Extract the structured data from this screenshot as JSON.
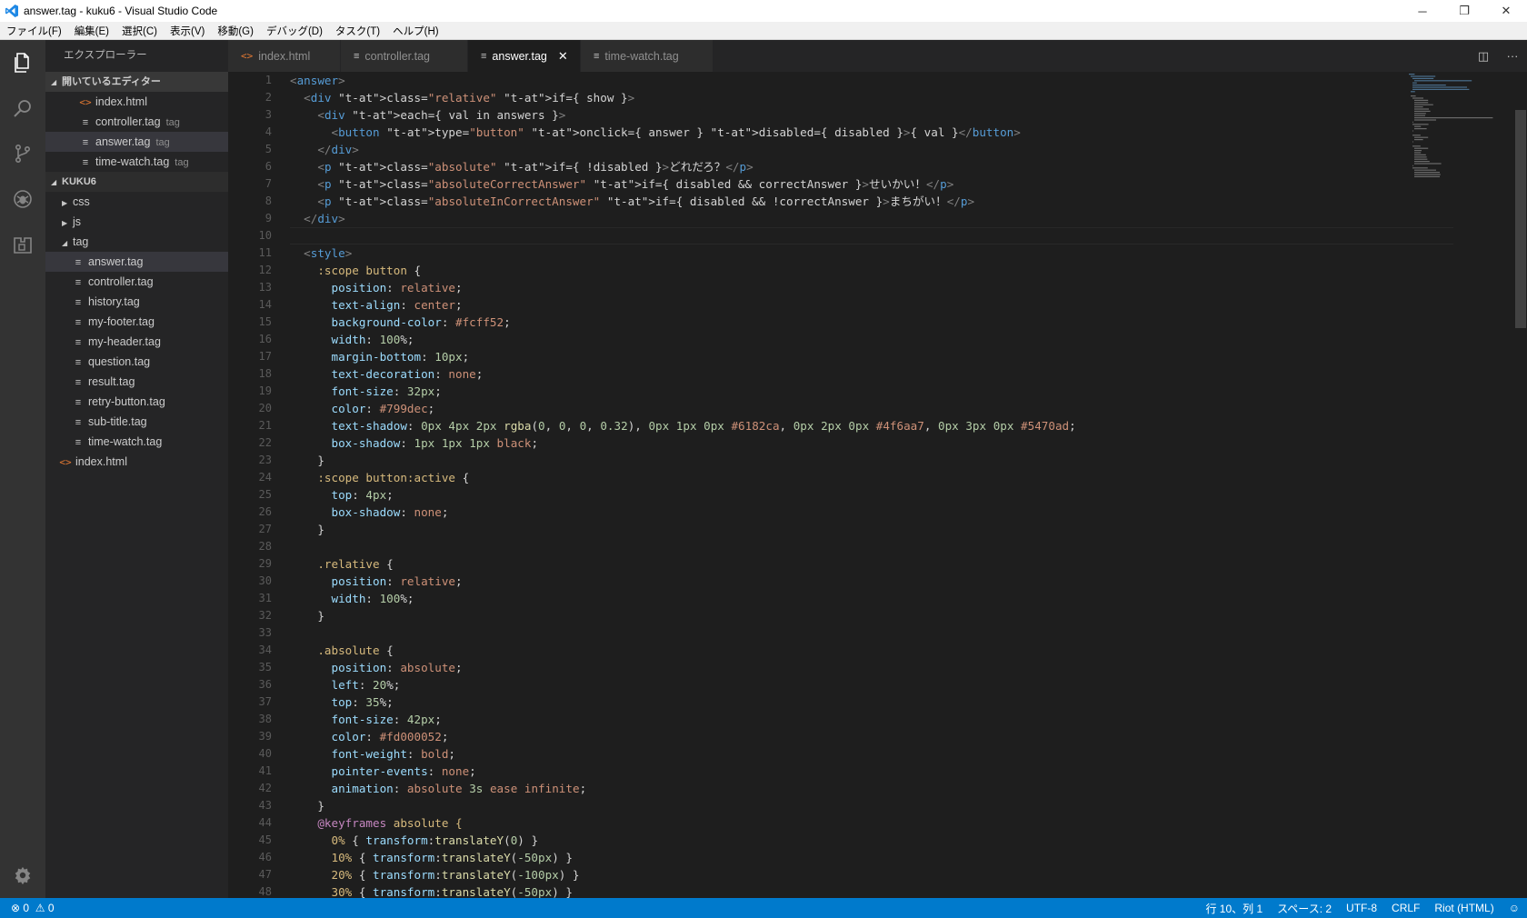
{
  "window": {
    "title": "answer.tag - kuku6 - Visual Studio Code",
    "controls": [
      "─",
      "❐",
      "✕"
    ]
  },
  "menu": [
    "ファイル(F)",
    "編集(E)",
    "選択(C)",
    "表示(V)",
    "移動(G)",
    "デバッグ(D)",
    "タスク(T)",
    "ヘルプ(H)"
  ],
  "sidebar": {
    "title": "エクスプローラー",
    "open_editors_label": "開いているエディター",
    "open_editors": [
      {
        "name": "index.html",
        "desc": "",
        "icon": "html"
      },
      {
        "name": "controller.tag",
        "desc": "tag",
        "icon": "file"
      },
      {
        "name": "answer.tag",
        "desc": "tag",
        "icon": "file"
      },
      {
        "name": "time-watch.tag",
        "desc": "tag",
        "icon": "file"
      }
    ],
    "project_label": "KUKU6",
    "folders": [
      "css",
      "js",
      "tag"
    ],
    "tag_files": [
      "answer.tag",
      "controller.tag",
      "history.tag",
      "my-footer.tag",
      "my-header.tag",
      "question.tag",
      "result.tag",
      "retry-button.tag",
      "sub-title.tag",
      "time-watch.tag"
    ],
    "root_file": "index.html"
  },
  "tabs": [
    {
      "label": "index.html",
      "icon": "html"
    },
    {
      "label": "controller.tag",
      "icon": "file"
    },
    {
      "label": "answer.tag",
      "icon": "file"
    },
    {
      "label": "time-watch.tag",
      "icon": "file"
    }
  ],
  "active_tab": 2,
  "colors": {
    "accent": "#007acc",
    "html_icon": "#e37933"
  },
  "code_lines": [
    "<answer>",
    "  <div class=\"relative\" if={ show }>",
    "    <div each={ val in answers }>",
    "      <button type=\"button\" onclick={ answer } disabled={ disabled }>{ val }</button>",
    "    </div>",
    "    <p class=\"absolute\" if={ !disabled }>どれだろ？</p>",
    "    <p class=\"absoluteCorrectAnswer\" if={ disabled && correctAnswer }>せいかい！</p>",
    "    <p class=\"absoluteInCorrectAnswer\" if={ disabled && !correctAnswer }>まちがい！</p>",
    "  </div>",
    "",
    "  <style>",
    "    :scope button {",
    "      position: relative;",
    "      text-align: center;",
    "      background-color: #fcff52;",
    "      width: 100%;",
    "      margin-bottom: 10px;",
    "      text-decoration: none;",
    "      font-size: 32px;",
    "      color: #799dec;",
    "      text-shadow: 0px 4px 2px rgba(0, 0, 0, 0.32), 0px 1px 0px #6182ca, 0px 2px 0px #4f6aa7, 0px 3px 0px #5470ad;",
    "      box-shadow: 1px 1px 1px black;",
    "    }",
    "    :scope button:active {",
    "      top: 4px;",
    "      box-shadow: none;",
    "    }",
    "",
    "    .relative {",
    "      position: relative;",
    "      width: 100%;",
    "    }",
    "",
    "    .absolute {",
    "      position: absolute;",
    "      left: 20%;",
    "      top: 35%;",
    "      font-size: 42px;",
    "      color: #fd000052;",
    "      font-weight: bold;",
    "      pointer-events: none;",
    "      animation: absolute 3s ease infinite;",
    "    }",
    "    @keyframes absolute {",
    "      0% { transform:translateY(0) }",
    "      10% { transform:translateY(-50px) }",
    "      20% { transform:translateY(-100px) }",
    "      30% { transform:translateY(-50px) }"
  ],
  "status": {
    "errors": "0",
    "warnings": "0",
    "position": "行 10、列 1",
    "indent": "スペース: 2",
    "encoding": "UTF-8",
    "eol": "CRLF",
    "language": "Riot (HTML)"
  }
}
